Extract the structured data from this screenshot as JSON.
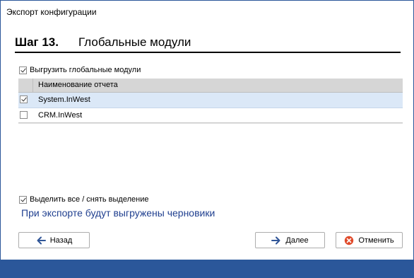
{
  "window": {
    "title": "Экспорт конфигурации"
  },
  "step": {
    "number": "Шаг 13.",
    "title": "Глобальные модули"
  },
  "export_option": {
    "label": "Выгрузить глобальные модули",
    "checked": true
  },
  "grid": {
    "column_header": "Наименование отчета",
    "rows": [
      {
        "name": "System.InWest",
        "checked": true,
        "selected": true
      },
      {
        "name": "CRM.InWest",
        "checked": false,
        "selected": false
      }
    ]
  },
  "select_all": {
    "label": "Выделить все / снять выделение",
    "checked": true
  },
  "notice": "При экспорте будут выгружены черновики",
  "buttons": {
    "back": "Назад",
    "next": "Далее",
    "cancel": "Отменить"
  },
  "colors": {
    "accent": "#2b579a",
    "notice_text": "#1f3f8f",
    "selected_row": "#dbe8f7",
    "cancel_icon": "#e04a2a",
    "arrow_icon": "#2f5597"
  },
  "icons": {
    "back": "arrow-left-icon",
    "next": "arrow-right-icon",
    "cancel": "cancel-icon"
  }
}
